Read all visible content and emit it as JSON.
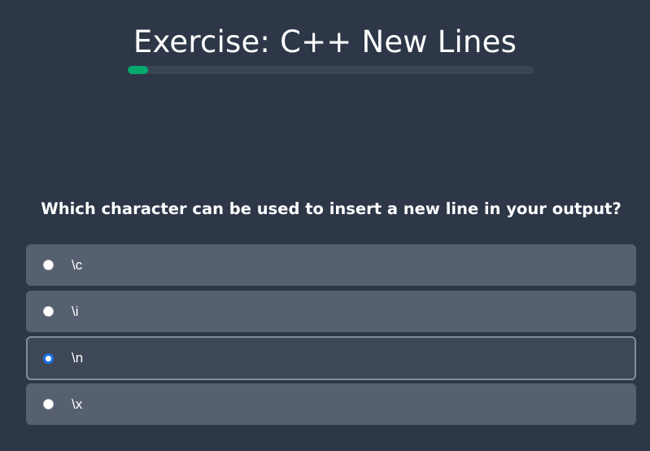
{
  "exercise": {
    "title": "Exercise: C++ New Lines",
    "progress_fraction": 0.05
  },
  "question": {
    "text": "Which character can be used to insert a new line in your output?"
  },
  "options": [
    {
      "label": "\\c",
      "selected": false
    },
    {
      "label": "\\i",
      "selected": false
    },
    {
      "label": "\\n",
      "selected": true
    },
    {
      "label": "\\x",
      "selected": false
    }
  ],
  "colors": {
    "background": "#2d3748",
    "progress_fill": "#04aa6d",
    "option_background": "#576070",
    "selected_radio": "#1a73e8"
  }
}
